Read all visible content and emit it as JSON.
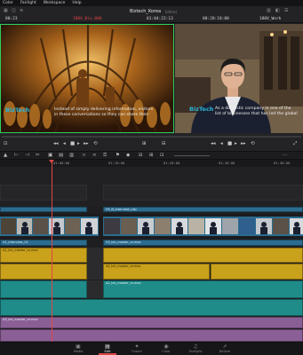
{
  "menu": [
    "Color",
    "Fairlight",
    "Workspace",
    "Help"
  ],
  "project_title": "Biztech_Korea",
  "project_status": "Edited",
  "header": {
    "left_timecode": "00:23",
    "clip_name": "180V_Bix_006",
    "center_timecode": "01:04:22:13",
    "right_timecode": "00:20:18:00",
    "timeline_name": "180V_Work"
  },
  "viewer_source": {
    "brand": "BizTech",
    "subtitle_line1": "Instead of simply delivering information, visitors",
    "subtitle_line2": "in these conversations so they can share their"
  },
  "viewer_program": {
    "brand": "BizTech",
    "subtitle_line1": "As a domestic company in one of the",
    "subtitle_line2": "list of businesses that has led the global"
  },
  "ruler_labels": [
    "01:00:00",
    "01:10:00",
    "01:20:00",
    "01:30:00",
    "01:40:00"
  ],
  "tracks": {
    "v2_clip_label": "V5_B_Interview_clip",
    "v1_clip_label": "V1_interview_01",
    "v1_clip2_label": "V3_bic_master_re.mov",
    "a1_label": "A1_bic_master_re.mov",
    "a1_label2": "A4_bic_master_re.mov",
    "a2_label": "A2_bic_master_re.mov",
    "a3_label": "A3_bic_master_re.mov"
  },
  "pages": [
    {
      "icon": "media-icon",
      "label": "Media"
    },
    {
      "icon": "edit-icon",
      "label": "Edit"
    },
    {
      "icon": "fusion-icon",
      "label": "Fusion"
    },
    {
      "icon": "color-icon",
      "label": "Color"
    },
    {
      "icon": "fairlight-icon",
      "label": "Fairlight"
    },
    {
      "icon": "deliver-icon",
      "label": "Deliver"
    }
  ],
  "active_page": "Edit",
  "colors": {
    "playhead": "#e04545",
    "video_clip": "#2b6c8f",
    "audio_gold": "#c9a11b",
    "audio_teal": "#1f8c8a",
    "audio_purple": "#8a5f96",
    "source_border": "#2fcf5c",
    "brand": "#2ab3d6"
  }
}
